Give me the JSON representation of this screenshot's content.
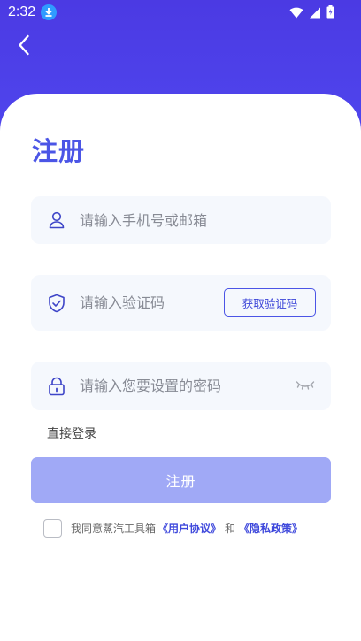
{
  "status_bar": {
    "time": "2:32"
  },
  "page": {
    "title": "注册"
  },
  "form": {
    "account_placeholder": "请输入手机号或邮箱",
    "code_placeholder": "请输入验证码",
    "get_code_label": "获取验证码",
    "password_placeholder": "请输入您要设置的密码"
  },
  "links": {
    "direct_login": "直接登录"
  },
  "submit": {
    "label": "注册"
  },
  "agreement": {
    "prefix": "我同意蒸汽工具箱",
    "user_agreement": "《用户协议》",
    "conjunction": "和",
    "privacy_policy": "《隐私政策》",
    "checked": false
  },
  "icons": {
    "back": "back-arrow-icon",
    "account": "user-icon",
    "code": "shield-check-icon",
    "password": "lock-icon",
    "visibility": "eye-closed-icon"
  },
  "colors": {
    "brand": "#4b55e6",
    "header": "#4a3be0",
    "button_disabled": "#a0a9f6",
    "field_bg": "#f5f8fd"
  }
}
